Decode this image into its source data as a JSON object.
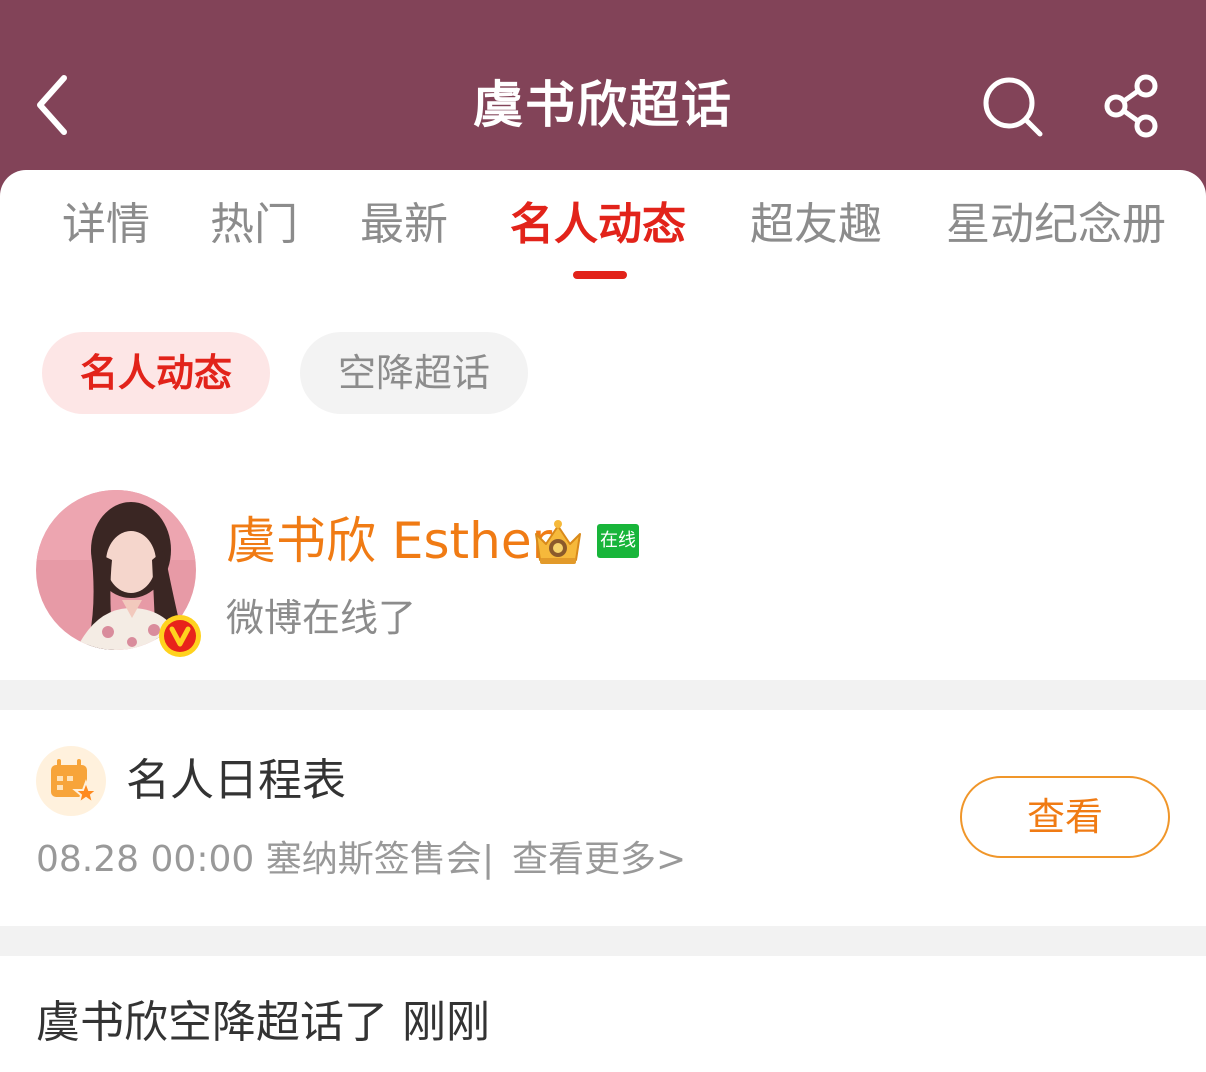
{
  "header": {
    "title": "虞书欣超话",
    "bg_color": "#824358",
    "back_icon": "chevron-left-icon",
    "search_icon": "search-icon",
    "share_icon": "share-icon"
  },
  "tabs": [
    {
      "label": "详情",
      "active": false
    },
    {
      "label": "热门",
      "active": false
    },
    {
      "label": "最新",
      "active": false
    },
    {
      "label": "名人动态",
      "active": true
    },
    {
      "label": "超友趣",
      "active": false
    },
    {
      "label": "星动纪念册",
      "active": false
    }
  ],
  "subtabs": [
    {
      "label": "名人动态",
      "active": true
    },
    {
      "label": "空降超话",
      "active": false
    }
  ],
  "profile": {
    "name": "虞书欣 Esther",
    "online_badge": "在线",
    "status": "微博在线了",
    "name_color": "#f07b14",
    "badges": [
      "verified-v-icon",
      "crown-icon"
    ]
  },
  "schedule": {
    "title": "名人日程表",
    "event": "08.28 00:00 塞纳斯签售会",
    "separator": "|",
    "more": "查看更多>",
    "button": "查看",
    "icon": "calendar-star-icon"
  },
  "feed": {
    "text": "虞书欣空降超话了 刚刚"
  },
  "colors": {
    "accent": "#e2231a",
    "orange": "#f07b14",
    "online": "#18b53a"
  }
}
